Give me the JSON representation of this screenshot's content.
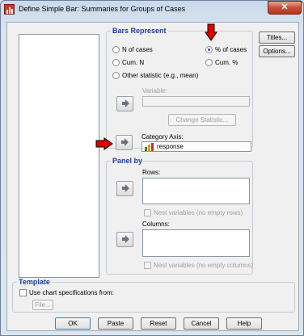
{
  "window": {
    "title": "Define Simple Bar: Summaries for Groups of Cases",
    "close_glyph": "✕"
  },
  "bars_represent": {
    "title": "Bars Represent",
    "options": [
      {
        "label": "N of cases",
        "selected": false
      },
      {
        "label": "% of cases",
        "selected": true
      },
      {
        "label": "Cum. N",
        "selected": false
      },
      {
        "label": "Cum. %",
        "selected": false
      },
      {
        "label": "Other statistic (e.g., mean)",
        "selected": false
      }
    ],
    "variable_label": "Variable:",
    "change_statistic_label": "Change Statistic..."
  },
  "category_axis": {
    "label": "Category Axis:",
    "value": "response"
  },
  "panel_by": {
    "title": "Panel by",
    "rows_label": "Rows:",
    "nest_rows_label": "Nest variables (no empty rows)",
    "columns_label": "Columns:",
    "nest_columns_label": "Nest variables (no empty columns)"
  },
  "template": {
    "title": "Template",
    "use_spec_label": "Use chart specifications from:",
    "file_label": "File..."
  },
  "side_buttons": {
    "titles": "Titles...",
    "options": "Options..."
  },
  "footer": {
    "ok": "OK",
    "paste": "Paste",
    "reset": "Reset",
    "cancel": "Cancel",
    "help": "Help"
  },
  "colors": {
    "group_title": "#1e3f9a",
    "annotation_arrow": "#e00000",
    "radio_dot": "#2a55c8"
  }
}
